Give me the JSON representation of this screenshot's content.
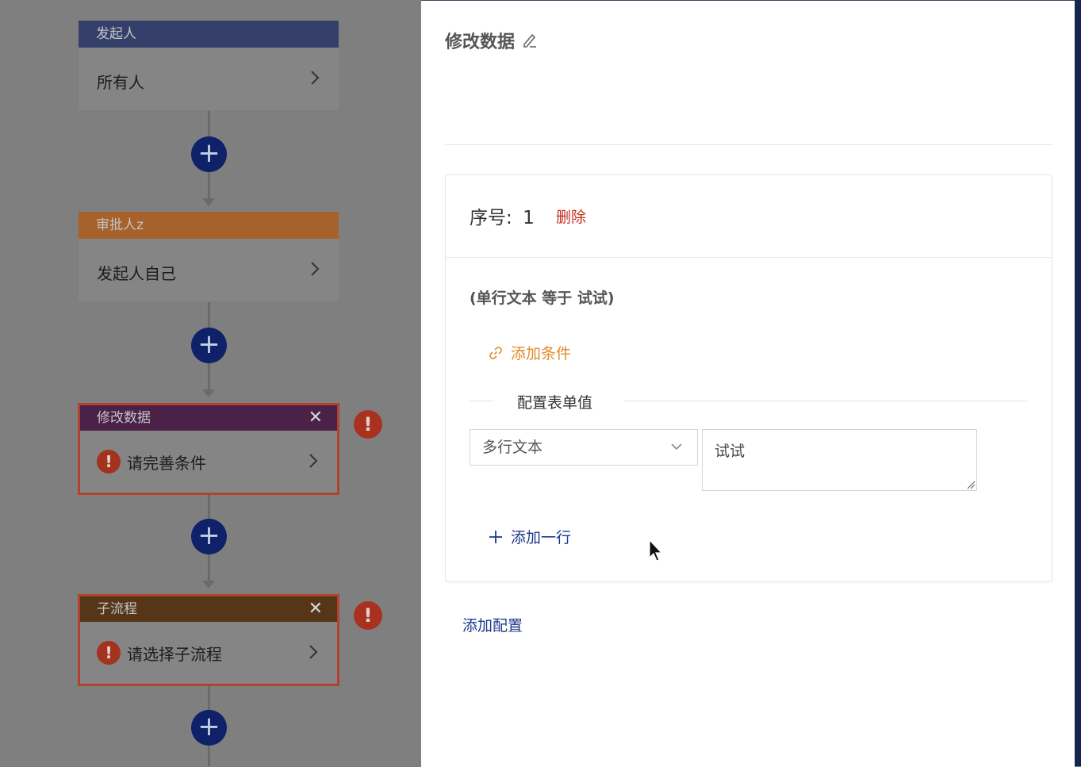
{
  "flow": {
    "nodes": [
      {
        "header": "发起人",
        "body": "所有人"
      },
      {
        "header": "审批人z",
        "body": "发起人自己"
      },
      {
        "header": "修改数据",
        "body": "请完善条件",
        "close": "✕",
        "error": "!"
      },
      {
        "header": "子流程",
        "body": "请选择子流程",
        "close": "✕",
        "error": "!"
      }
    ],
    "add_label": "+",
    "side_error": "!"
  },
  "drawer": {
    "title": "修改数据",
    "card": {
      "seq_label": "序号:",
      "seq_value": "1",
      "delete_label": "删除",
      "condition_text": "(单行文本 等于 试试)",
      "add_condition_label": "添加条件",
      "section_label": "配置表单值",
      "field_select_value": "多行文本",
      "field_value": "试试",
      "add_row_label": "添加一行"
    },
    "add_config_label": "添加配置"
  },
  "colors": {
    "primary": "#1f3a8c",
    "danger": "#c42d1d",
    "warning": "#e08b2b"
  }
}
